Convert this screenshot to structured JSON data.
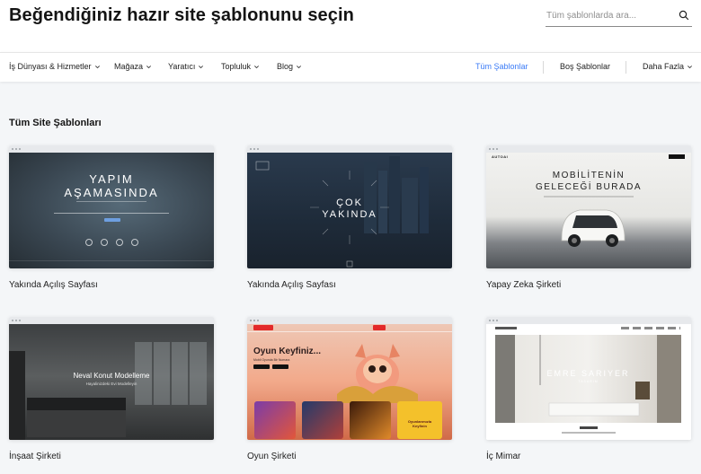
{
  "header": {
    "title": "Beğendiğiniz hazır site şablonunu seçin",
    "search_placeholder": "Tüm şablonlarda ara..."
  },
  "nav": {
    "items": [
      {
        "label": "İş Dünyası & Hizmetler"
      },
      {
        "label": "Mağaza"
      },
      {
        "label": "Yaratıcı"
      },
      {
        "label": "Topluluk"
      },
      {
        "label": "Blog"
      }
    ],
    "active": "Tüm Şablonlar",
    "blank": "Boş Şablonlar",
    "more": "Daha Fazla"
  },
  "section_title": "Tüm Site Şablonları",
  "templates": [
    {
      "name": "Yakında Açılış Sayfası",
      "overlay": [
        "YAPIM",
        "AŞAMASINDA"
      ]
    },
    {
      "name": "Yakında Açılış Sayfası",
      "overlay": [
        "ÇOK",
        "YAKINDA"
      ]
    },
    {
      "name": "Yapay Zeka Şirketi",
      "overlay": [
        "MOBİLİTENİN",
        "GELECEĞİ BURADA"
      ],
      "brand": "AUTOAI"
    },
    {
      "name": "İnşaat Şirketi",
      "overlay": [
        "Neval Konut Modelleme",
        "Hayalinizdeki Evi Modelleyin"
      ]
    },
    {
      "name": "Oyun Şirketi",
      "overlay": [
        "Oyun Keyfiniz...",
        "Mobil Oyunda Bir Numara"
      ],
      "promo": "Oyunlarımızla Keyfinin"
    },
    {
      "name": "İç Mimar",
      "overlay": [
        "EMRE SARIYER",
        "TASARIM"
      ]
    }
  ],
  "colors": {
    "accent": "#3b7bf6",
    "page_bg": "#f4f6f8"
  }
}
